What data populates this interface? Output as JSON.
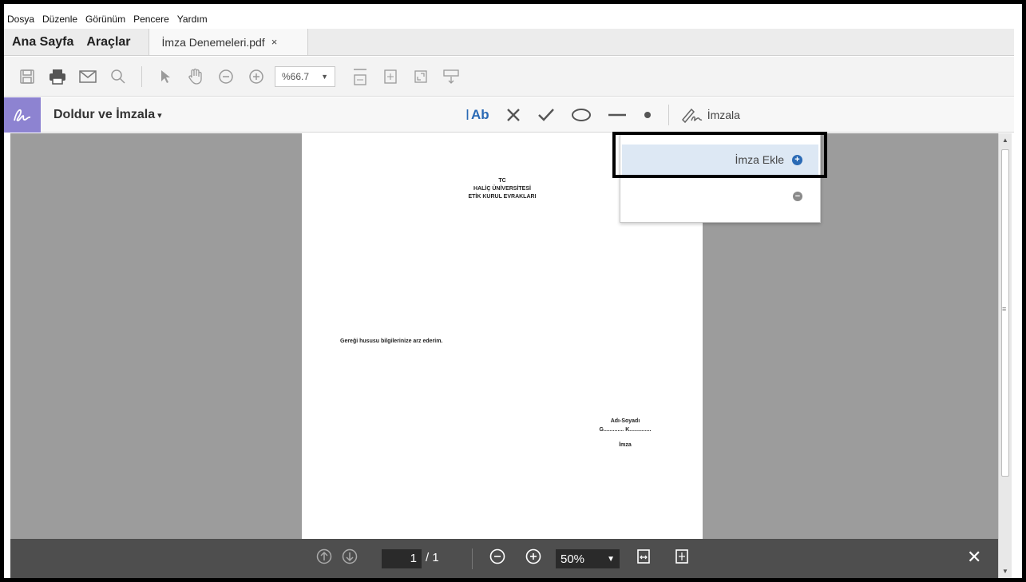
{
  "menu": [
    "Dosya",
    "Düzenle",
    "Görünüm",
    "Pencere",
    "Yardım"
  ],
  "tabs": {
    "home": "Ana Sayfa",
    "tools": "Araçlar",
    "document": "İmza Denemeleri.pdf",
    "close": "×"
  },
  "toolbar": {
    "zoom": "%66.7",
    "icons": [
      "save-icon",
      "print-icon",
      "email-icon",
      "search-icon",
      "select-arrow-icon",
      "hand-icon",
      "zoom-out-icon",
      "zoom-in-icon",
      "fit-width-icon",
      "fit-page-icon",
      "fullscreen-icon",
      "keyboard-icon"
    ]
  },
  "fillsign": {
    "title": "Doldur ve İmzala",
    "caret": "▾",
    "text_tool": "Ab",
    "sign_label": "İmzala"
  },
  "document": {
    "head": [
      "TC",
      "HALİÇ ÜNİVERSİTESİ",
      "ETİK KURUL EVRAKLARI"
    ],
    "body": "Gereği hususu bilgilerinize arz ederim.",
    "sig_label": "Adı-Soyadı",
    "sig_line": "G............. K..............",
    "sig_word": "İmza"
  },
  "sig_menu": {
    "add_label": "İmza Ekle"
  },
  "bottombar": {
    "page_current": "1",
    "page_total": "/ 1",
    "zoom": "50%",
    "close": "✕"
  },
  "colors": {
    "accent": "#2a6ab5",
    "fillsign_logo": "#8d83d1",
    "doc_background": "#9c9c9c",
    "bottom_bar": "#4e4e4e"
  }
}
